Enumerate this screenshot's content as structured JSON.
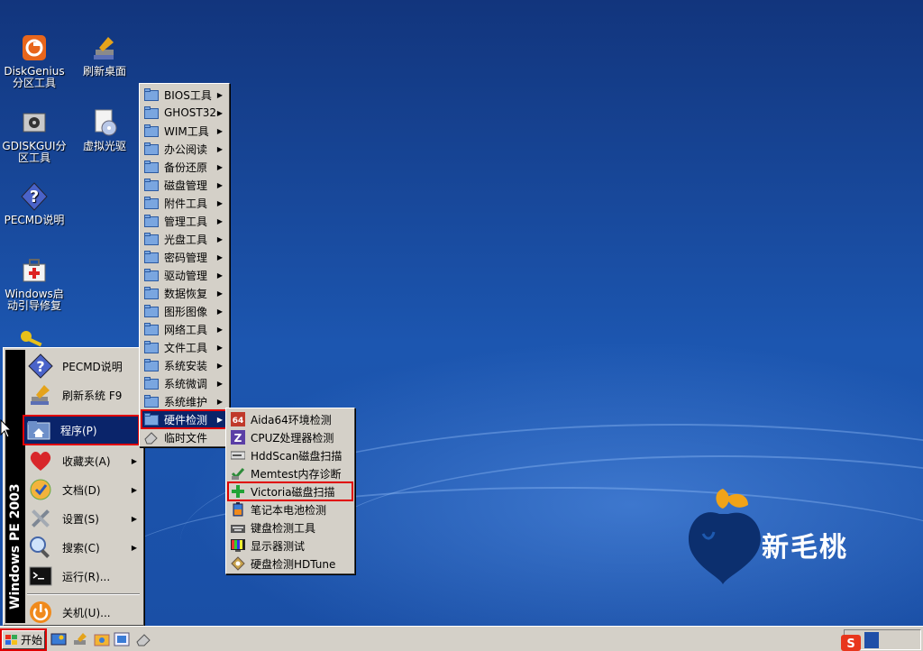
{
  "desktop": {
    "icons": [
      {
        "label": "DiskGenius分区工具"
      },
      {
        "label": "刷新桌面"
      },
      {
        "label": "GDISKGUI分区工具"
      },
      {
        "label": "虚拟光驱"
      },
      {
        "label": "PECMD说明"
      },
      {
        "label": "Windows启动引导修复"
      }
    ],
    "brand": "新毛桃"
  },
  "start_menu": {
    "sidebar_text": "Windows PE 2003",
    "items": [
      {
        "label": "PECMD说明"
      },
      {
        "label": "刷新系统 F9"
      },
      {
        "label": "程序(P)"
      },
      {
        "label": "收藏夹(A)"
      },
      {
        "label": "文档(D)"
      },
      {
        "label": "设置(S)"
      },
      {
        "label": "搜索(C)"
      },
      {
        "label": "运行(R)..."
      },
      {
        "label": "关机(U)..."
      }
    ]
  },
  "programs_menu": {
    "items": [
      {
        "label": "BIOS工具"
      },
      {
        "label": "GHOST32"
      },
      {
        "label": "WIM工具"
      },
      {
        "label": "办公阅读"
      },
      {
        "label": "备份还原"
      },
      {
        "label": "磁盘管理"
      },
      {
        "label": "附件工具"
      },
      {
        "label": "管理工具"
      },
      {
        "label": "光盘工具"
      },
      {
        "label": "密码管理"
      },
      {
        "label": "驱动管理"
      },
      {
        "label": "数据恢复"
      },
      {
        "label": "图形图像"
      },
      {
        "label": "网络工具"
      },
      {
        "label": "文件工具"
      },
      {
        "label": "系统安装"
      },
      {
        "label": "系统微调"
      },
      {
        "label": "系统维护"
      },
      {
        "label": "硬件检测"
      },
      {
        "label": "临时文件"
      }
    ]
  },
  "hardware_menu": {
    "items": [
      {
        "label": "Aida64环境检测"
      },
      {
        "label": "CPUZ处理器检测"
      },
      {
        "label": "HddScan磁盘扫描"
      },
      {
        "label": "Memtest内存诊断"
      },
      {
        "label": "Victoria磁盘扫描"
      },
      {
        "label": "笔记本电池检测"
      },
      {
        "label": "键盘检测工具"
      },
      {
        "label": "显示器测试"
      },
      {
        "label": "硬盘检测HDTune"
      }
    ]
  },
  "taskbar": {
    "start_label": "开始"
  },
  "colors": {
    "selection": "#0a246a",
    "highlight_box": "#e00000",
    "menu_bg": "#d4d0c8"
  }
}
